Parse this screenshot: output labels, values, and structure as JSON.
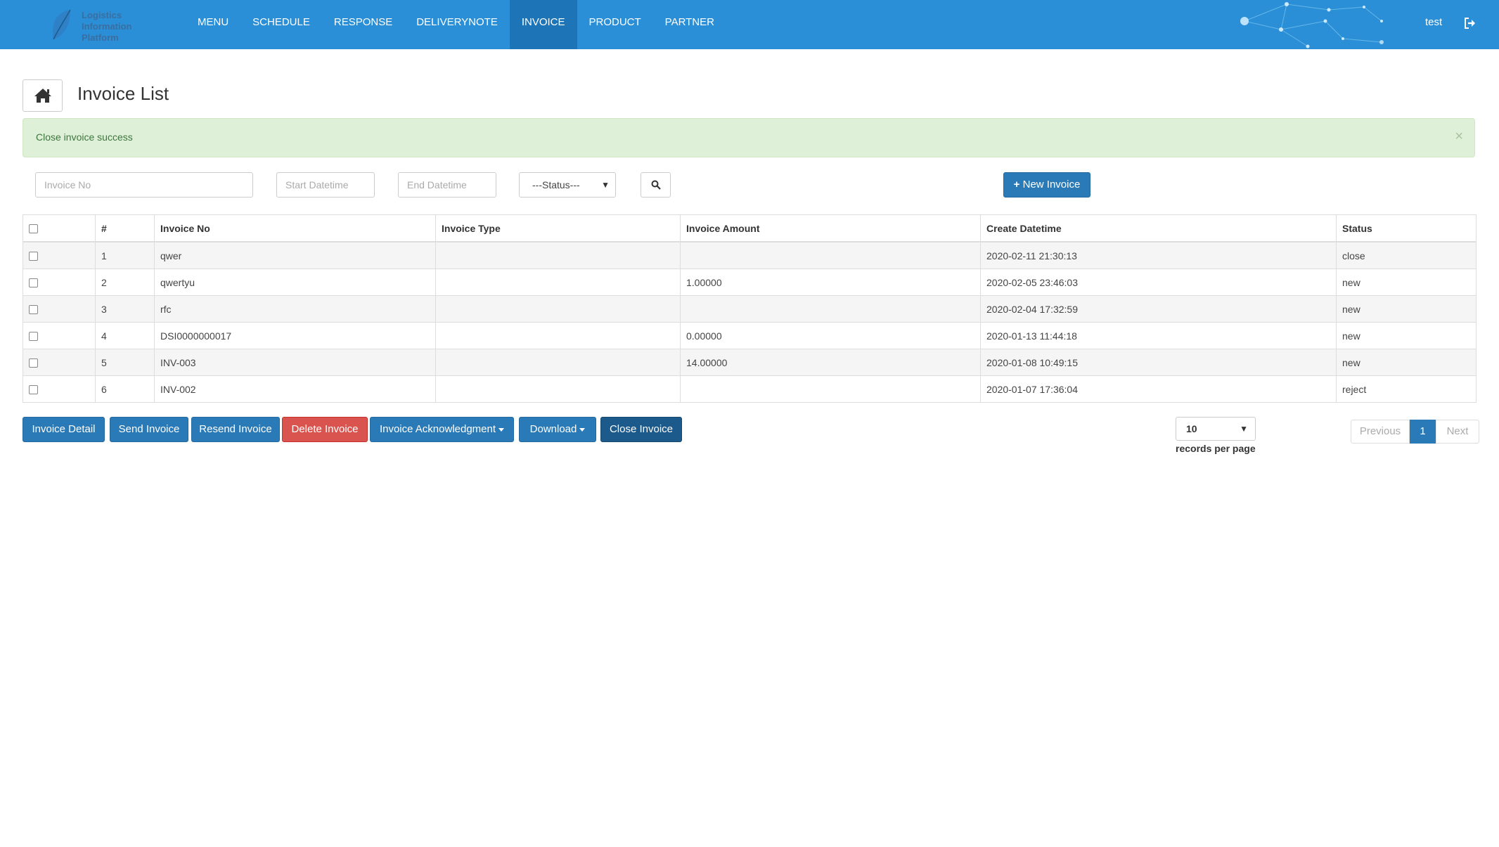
{
  "brand": {
    "logo_lines": [
      "Logistics",
      "Information",
      "Platform"
    ]
  },
  "nav": {
    "items": [
      "MENU",
      "SCHEDULE",
      "RESPONSE",
      "DELIVERYNOTE",
      "INVOICE",
      "PRODUCT",
      "PARTNER"
    ],
    "active": "INVOICE",
    "user": "test",
    "logout_icon": "sign-out-icon"
  },
  "page": {
    "title": "Invoice List",
    "home_icon": "home-icon"
  },
  "alert": {
    "message": "Close invoice success",
    "close": "×",
    "color": "#dff0d8"
  },
  "filters": {
    "invoice_no_placeholder": "Invoice No",
    "start_placeholder": "Start Datetime",
    "end_placeholder": "End Datetime",
    "status_selected": "---Status---",
    "search_icon": "search-icon",
    "new_invoice_label": "New Invoice",
    "new_invoice_icon": "+"
  },
  "table": {
    "headers": [
      "",
      "#",
      "Invoice No",
      "Invoice Type",
      "Invoice Amount",
      "Create Datetime",
      "Status"
    ],
    "rows": [
      {
        "num": "1",
        "no": "qwer",
        "type": "",
        "amount": "",
        "created": "2020-02-11 21:30:13",
        "status": "close"
      },
      {
        "num": "2",
        "no": "qwertyu",
        "type": "",
        "amount": "1.00000",
        "created": "2020-02-05 23:46:03",
        "status": "new"
      },
      {
        "num": "3",
        "no": "rfc",
        "type": "",
        "amount": "",
        "created": "2020-02-04 17:32:59",
        "status": "new"
      },
      {
        "num": "4",
        "no": "DSI0000000017",
        "type": "",
        "amount": "0.00000",
        "created": "2020-01-13 11:44:18",
        "status": "new"
      },
      {
        "num": "5",
        "no": "INV-003",
        "type": "",
        "amount": "14.00000",
        "created": "2020-01-08 10:49:15",
        "status": "new"
      },
      {
        "num": "6",
        "no": "INV-002",
        "type": "",
        "amount": "",
        "created": "2020-01-07 17:36:04",
        "status": "reject"
      }
    ]
  },
  "actions": {
    "invoice_detail": "Invoice Detail",
    "send_invoice": "Send Invoice",
    "resend_invoice": "Resend Invoice",
    "delete_invoice": "Delete Invoice",
    "invoice_ack": "Invoice Acknowledgment",
    "download": "Download",
    "close_invoice": "Close Invoice"
  },
  "pagination": {
    "records_per_page": "10",
    "records_label": "records per page",
    "previous": "Previous",
    "current": "1",
    "next": "Next"
  },
  "colors": {
    "navbar": "#2a8fd6",
    "primary": "#2a7ab8",
    "danger": "#d9534f"
  }
}
